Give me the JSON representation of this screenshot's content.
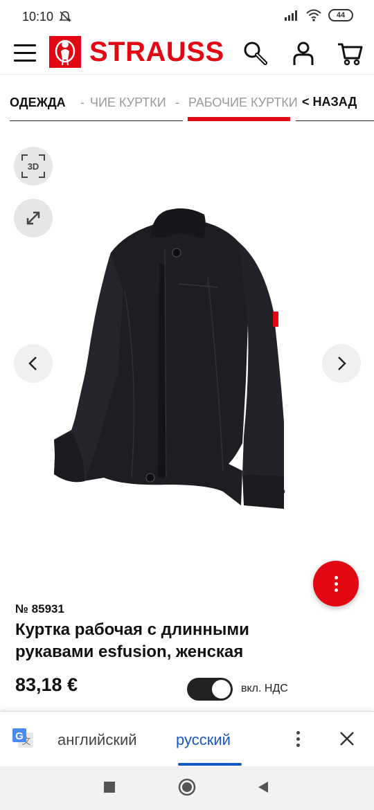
{
  "status_bar": {
    "time": "10:10",
    "battery": "44",
    "icons": [
      "dnd-off-icon",
      "signal-icon",
      "wifi-icon",
      "battery-icon"
    ]
  },
  "header": {
    "brand": "STRAUSS",
    "icons": [
      "menu-icon",
      "search-icon",
      "account-icon",
      "cart-icon"
    ],
    "brand_color": "#e30613"
  },
  "breadcrumb": {
    "items": [
      "ОДЕЖДА",
      "-",
      "ЧИЕ КУРТКИ",
      "-",
      "РАБОЧИЕ КУРТКИ"
    ],
    "back_label": "< НАЗАД"
  },
  "gallery": {
    "btn_3d_label": "3D",
    "icons": [
      "expand-icon",
      "chevron-left-icon",
      "chevron-right-icon",
      "more-vertical-icon"
    ]
  },
  "product": {
    "article_no": "№ 85931",
    "title": "Куртка рабочая с длинными рукавами esfusion, женская",
    "price": "83,18 €",
    "vat_toggle_on": true,
    "vat_label": "вкл. НДС"
  },
  "translate_bar": {
    "source_lang": "английский",
    "target_lang": "русский",
    "active": "русский",
    "accent": "#1a56c4",
    "icons": [
      "google-translate-icon",
      "more-vertical-icon",
      "close-icon"
    ]
  },
  "nav_bar": {
    "icons": [
      "recents-icon",
      "home-icon",
      "back-icon"
    ]
  }
}
